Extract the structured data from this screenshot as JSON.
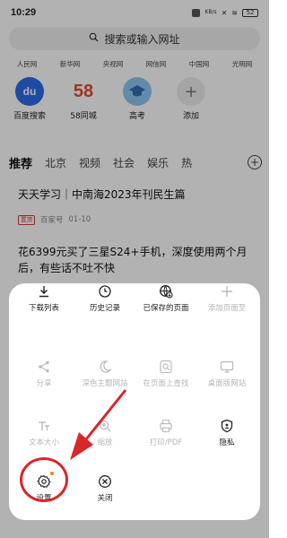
{
  "status_bar": {
    "time": "10:29",
    "battery": "52",
    "speed": "KB/s"
  },
  "search": {
    "placeholder": "搜索或输入网址"
  },
  "quick_sites": [
    "人民网",
    "新华网",
    "央视网",
    "网信网",
    "中国网",
    "光明网"
  ],
  "apps": [
    {
      "label": "百度搜索",
      "icon": "baidu-icon",
      "glyph": "du"
    },
    {
      "label": "58同城",
      "icon": "58-icon",
      "glyph": "58"
    },
    {
      "label": "高考",
      "icon": "gaokao-icon",
      "glyph": ""
    },
    {
      "label": "添加",
      "icon": "add-icon",
      "glyph": "+"
    }
  ],
  "channels": [
    "推荐",
    "北京",
    "视频",
    "社会",
    "娱乐",
    "热"
  ],
  "news": [
    {
      "title": "天天学习｜中南海2023年刊民生篇",
      "tag": "置顶",
      "source": "百家号",
      "date": "01-10"
    },
    {
      "title": "花6399元买了三星S24+手机，深度使用两个月后，有些话不吐不快"
    }
  ],
  "menu": {
    "items": [
      {
        "label": "下载列表",
        "icon": "download-icon",
        "enabled": true
      },
      {
        "label": "历史记录",
        "icon": "history-icon",
        "enabled": true
      },
      {
        "label": "已保存的页面",
        "icon": "saved-pages-icon",
        "enabled": true
      },
      {
        "label": "添加页面至",
        "icon": "add-page-icon",
        "enabled": false
      },
      {
        "label": "分享",
        "icon": "share-icon",
        "enabled": false
      },
      {
        "label": "深色主题网站",
        "icon": "dark-theme-icon",
        "enabled": false
      },
      {
        "label": "在页面上查找",
        "icon": "find-in-page-icon",
        "enabled": false
      },
      {
        "label": "桌面版网站",
        "icon": "desktop-site-icon",
        "enabled": false
      },
      {
        "label": "文本大小",
        "icon": "text-size-icon",
        "enabled": false
      },
      {
        "label": "缩放",
        "icon": "zoom-icon",
        "enabled": false
      },
      {
        "label": "打印/PDF",
        "icon": "print-icon",
        "enabled": false
      },
      {
        "label": "隐私",
        "icon": "privacy-icon",
        "enabled": true
      },
      {
        "label": "设置",
        "icon": "settings-icon",
        "enabled": true
      },
      {
        "label": "关闭",
        "icon": "close-icon",
        "enabled": true
      }
    ]
  },
  "colors": {
    "annotation": "#d9262a",
    "notification_dot": "#ff7a22",
    "tag_red": "#dd3333"
  }
}
